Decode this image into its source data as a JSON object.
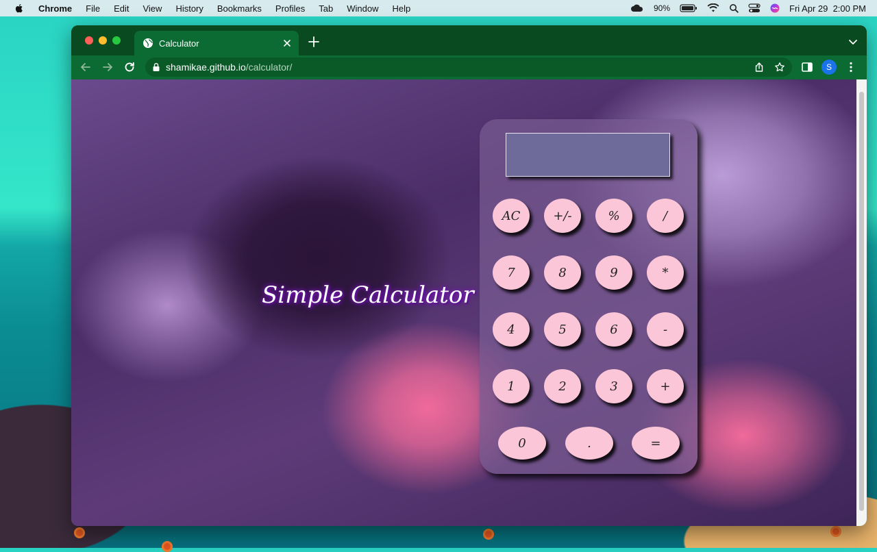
{
  "menubar": {
    "app_name": "Chrome",
    "items": [
      "File",
      "Edit",
      "View",
      "History",
      "Bookmarks",
      "Profiles",
      "Tab",
      "Window",
      "Help"
    ],
    "battery": "90%",
    "datetime": "Fri Apr 29  2:00 PM"
  },
  "browser": {
    "tab_title": "Calculator",
    "url_host": "shamikae.github.io",
    "url_path": "/calculator/",
    "profile_initial": "S",
    "accent_color": "#0c6b32"
  },
  "page": {
    "heading": "Simple Calculator",
    "display_value": "",
    "keys": {
      "row1": [
        "AC",
        "+/-",
        "%",
        "/"
      ],
      "row2": [
        "7",
        "8",
        "9",
        "*"
      ],
      "row3": [
        "4",
        "5",
        "6",
        "-"
      ],
      "row4": [
        "1",
        "2",
        "3",
        "+"
      ],
      "row5": [
        "0",
        ".",
        "="
      ]
    },
    "key_color": "#fbc6d7"
  }
}
